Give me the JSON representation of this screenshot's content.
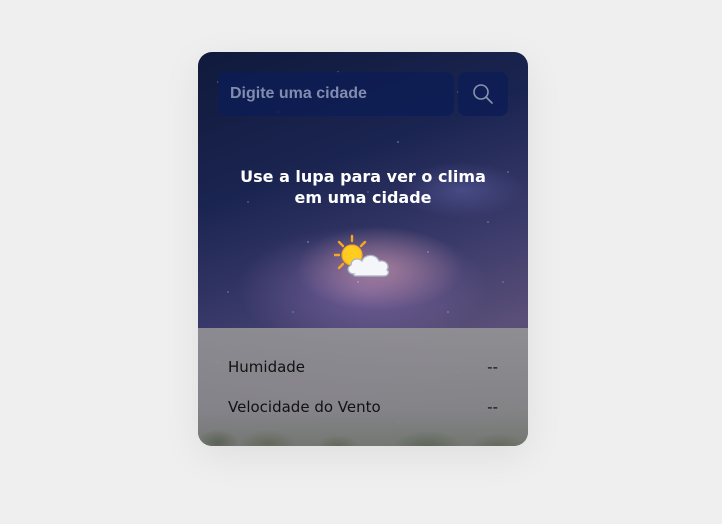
{
  "search": {
    "placeholder": "Digite uma cidade",
    "button_icon": "search-icon"
  },
  "headline": {
    "line1": "Use a lupa para ver o clima",
    "line2": "em uma cidade"
  },
  "weather_icon": "sun-behind-cloud-icon",
  "details": {
    "humidity_label": "Humidade",
    "humidity_value": "--",
    "wind_label": "Velocidade do Vento",
    "wind_value": "--"
  },
  "colors": {
    "page_background": "#efefef",
    "input_background": "#0c1c54",
    "panel_background": "#969696",
    "headline_text": "#ffffff"
  }
}
